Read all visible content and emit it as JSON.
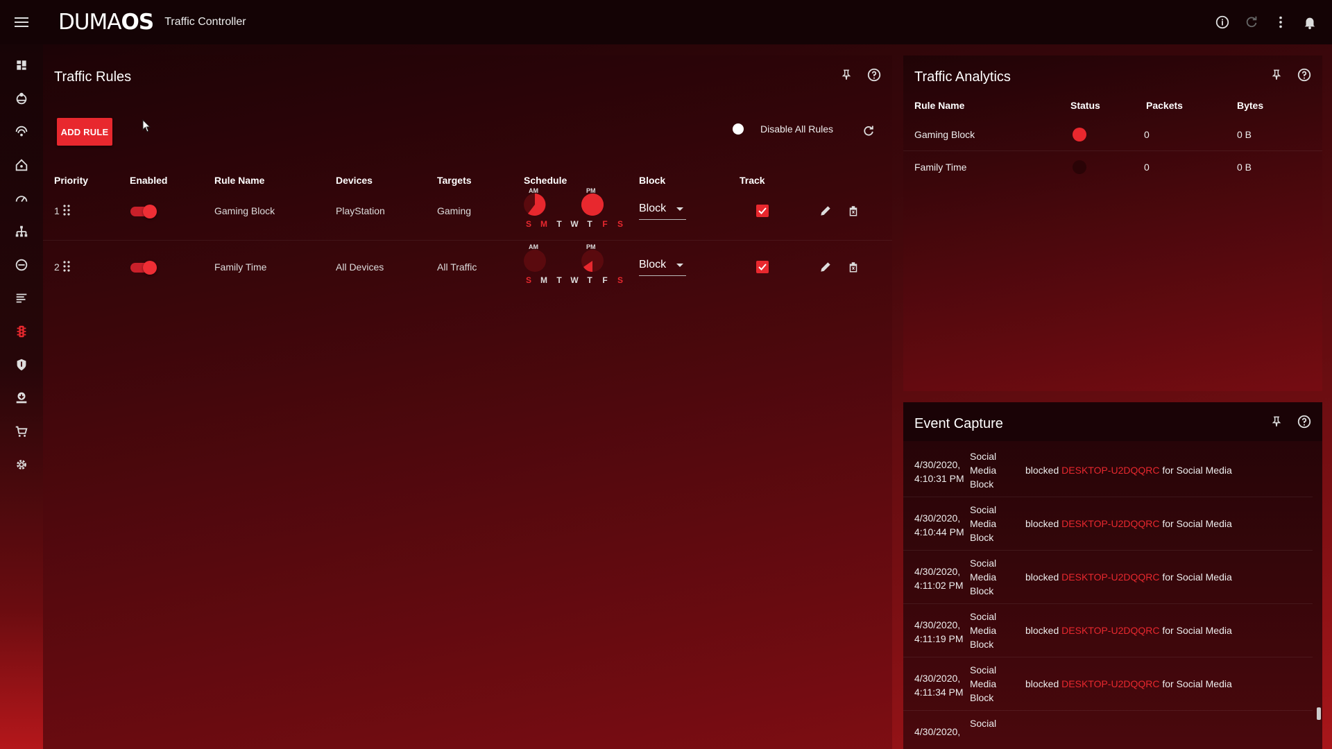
{
  "app": {
    "logo_bold": "DUMA",
    "logo_regular": "OS",
    "title": "Traffic Controller"
  },
  "colors": {
    "accent": "#e8282e",
    "background_dark": "#140305",
    "text": "#e8e8e8"
  },
  "topbar_icons": [
    "info-icon",
    "refresh-icon",
    "more-vert-icon",
    "bell-icon"
  ],
  "sidebar": {
    "items": [
      {
        "name": "dashboard-icon"
      },
      {
        "name": "geo-filter-icon"
      },
      {
        "name": "ping-heatmap-icon"
      },
      {
        "name": "network-home-icon"
      },
      {
        "name": "speedometer-icon"
      },
      {
        "name": "network-map-icon"
      },
      {
        "name": "block-icon"
      },
      {
        "name": "logs-icon"
      },
      {
        "name": "traffic-light-icon",
        "active": true
      },
      {
        "name": "shield-icon"
      },
      {
        "name": "user-download-icon"
      },
      {
        "name": "cart-icon"
      },
      {
        "name": "settings-icon"
      }
    ]
  },
  "rules_panel": {
    "title": "Traffic Rules",
    "add_rule_label": "ADD RULE",
    "disable_all_label": "Disable All Rules",
    "headers": {
      "priority": "Priority",
      "enabled": "Enabled",
      "rule_name": "Rule Name",
      "devices": "Devices",
      "targets": "Targets",
      "schedule": "Schedule",
      "block": "Block",
      "track": "Track"
    },
    "schedule_labels": {
      "am": "AM",
      "pm": "PM"
    },
    "day_letters": [
      "S",
      "M",
      "T",
      "W",
      "T",
      "F",
      "S"
    ],
    "rows": [
      {
        "priority": "1",
        "enabled": true,
        "rule_name": "Gaming Block",
        "devices": "PlayStation",
        "targets": "Gaming",
        "active_days": [
          true,
          true,
          false,
          false,
          false,
          true,
          true
        ],
        "block_value": "Block",
        "track": true
      },
      {
        "priority": "2",
        "enabled": true,
        "rule_name": "Family Time",
        "devices": "All Devices",
        "targets": "All Traffic",
        "active_days": [
          true,
          false,
          false,
          false,
          false,
          false,
          true
        ],
        "block_value": "Block",
        "track": true
      }
    ]
  },
  "analytics_panel": {
    "title": "Traffic Analytics",
    "headers": {
      "rule_name": "Rule Name",
      "status": "Status",
      "packets": "Packets",
      "bytes": "Bytes"
    },
    "rows": [
      {
        "rule_name": "Gaming Block",
        "status_color": "#e8282e",
        "packets": "0",
        "bytes": "0 B"
      },
      {
        "rule_name": "Family Time",
        "status_color": "#2a0306",
        "packets": "0",
        "bytes": "0 B"
      }
    ]
  },
  "events_panel": {
    "title": "Event Capture",
    "events": [
      {
        "date": "4/30/2020,",
        "time": "4:10:31 PM",
        "type": [
          "Social",
          "Media",
          "Block"
        ],
        "action": "blocked",
        "device": "DESKTOP-U2DQQRC",
        "suffix": "for Social Media"
      },
      {
        "date": "4/30/2020,",
        "time": "4:10:44 PM",
        "type": [
          "Social",
          "Media",
          "Block"
        ],
        "action": "blocked",
        "device": "DESKTOP-U2DQQRC",
        "suffix": "for Social Media"
      },
      {
        "date": "4/30/2020,",
        "time": "4:11:02 PM",
        "type": [
          "Social",
          "Media",
          "Block"
        ],
        "action": "blocked",
        "device": "DESKTOP-U2DQQRC",
        "suffix": "for Social Media"
      },
      {
        "date": "4/30/2020,",
        "time": "4:11:19 PM",
        "type": [
          "Social",
          "Media",
          "Block"
        ],
        "action": "blocked",
        "device": "DESKTOP-U2DQQRC",
        "suffix": "for Social Media"
      },
      {
        "date": "4/30/2020,",
        "time": "4:11:34 PM",
        "type": [
          "Social",
          "Media",
          "Block"
        ],
        "action": "blocked",
        "device": "DESKTOP-U2DQQRC",
        "suffix": "for Social Media"
      },
      {
        "date": "4/30/2020,",
        "time": "",
        "type": [
          "Social",
          "",
          ""
        ],
        "action": "",
        "device": "",
        "suffix": ""
      }
    ]
  }
}
